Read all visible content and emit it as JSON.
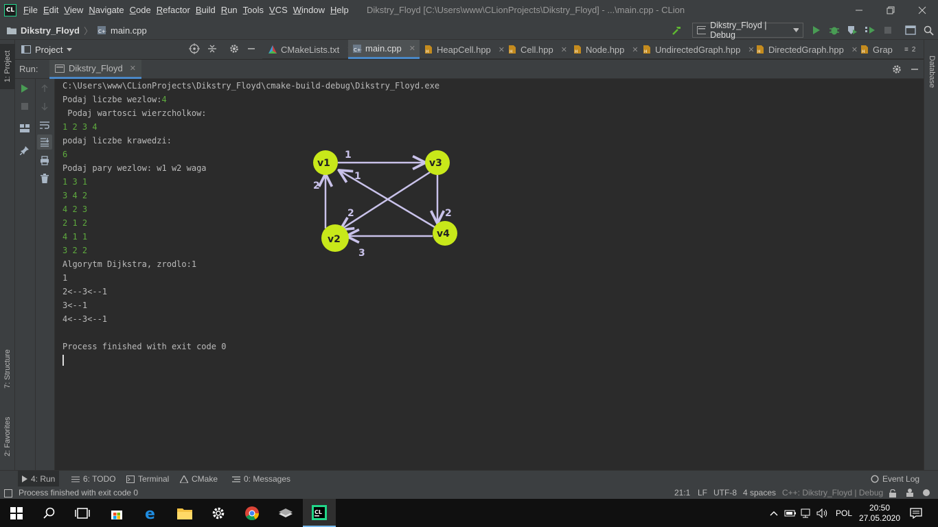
{
  "window": {
    "app_logo": "CL",
    "title": "Dikstry_Floyd [C:\\Users\\www\\CLionProjects\\Dikstry_Floyd] - ...\\main.cpp - CLion",
    "minimize_icon": "minimize-icon",
    "restore_icon": "restore-icon",
    "close_icon": "close-icon"
  },
  "menu": [
    "File",
    "Edit",
    "View",
    "Navigate",
    "Code",
    "Refactor",
    "Build",
    "Run",
    "Tools",
    "VCS",
    "Window",
    "Help"
  ],
  "navbar": {
    "project": "Dikstry_Floyd",
    "file": "main.cpp",
    "run_config": "Dikstry_Floyd | Debug"
  },
  "left_strip": {
    "project_tab": "1: Project",
    "structure_tab": "7: Structure",
    "favorites_tab": "2: Favorites"
  },
  "right_strip": {
    "database_tab": "Database"
  },
  "project_panel": {
    "label": "Project"
  },
  "tabs": [
    {
      "label": "CMakeLists.txt",
      "icon": "cmake-icon"
    },
    {
      "label": "main.cpp",
      "icon": "cpp-file-icon",
      "active": true
    },
    {
      "label": "HeapCell.hpp",
      "icon": "header-file-icon"
    },
    {
      "label": "Cell.hpp",
      "icon": "header-file-icon"
    },
    {
      "label": "Node.hpp",
      "icon": "header-file-icon"
    },
    {
      "label": "UndirectedGraph.hpp",
      "icon": "header-file-icon"
    },
    {
      "label": "DirectedGraph.hpp",
      "icon": "header-file-icon"
    },
    {
      "label": "Grap",
      "icon": "header-file-icon"
    }
  ],
  "tabs_overflow": "2",
  "run_panel": {
    "label": "Run:",
    "tab": "Dikstry_Floyd"
  },
  "console": {
    "lines": [
      {
        "text": "C:\\Users\\www\\CLionProjects\\Dikstry_Floyd\\cmake-build-debug\\Dikstry_Floyd.exe",
        "input": ""
      },
      {
        "text": "Podaj liczbe wezlow:",
        "input": "4"
      },
      {
        "text": " Podaj wartosci wierzcholkow:",
        "input": ""
      },
      {
        "text": "",
        "input": "1 2 3 4"
      },
      {
        "text": "podaj liczbe krawedzi:",
        "input": ""
      },
      {
        "text": "",
        "input": "6"
      },
      {
        "text": "Podaj pary wezlow: w1 w2 waga",
        "input": ""
      },
      {
        "text": "",
        "input": "1 3 1"
      },
      {
        "text": "",
        "input": "3 4 2"
      },
      {
        "text": "",
        "input": "4 2 3"
      },
      {
        "text": "",
        "input": "2 1 2"
      },
      {
        "text": "",
        "input": "4 1 1"
      },
      {
        "text": "",
        "input": "3 2 2"
      },
      {
        "text": "Algorytm Dijkstra, zrodlo:1",
        "input": ""
      },
      {
        "text": "1",
        "input": ""
      },
      {
        "text": "2<--3<--1",
        "input": ""
      },
      {
        "text": "3<--1",
        "input": ""
      },
      {
        "text": "4<--3<--1",
        "input": ""
      },
      {
        "text": "",
        "input": ""
      },
      {
        "text": "Process finished with exit code 0",
        "input": ""
      }
    ]
  },
  "graph": {
    "nodes": [
      "v1",
      "v2",
      "v3",
      "v4"
    ],
    "node_color": "#c8e81a",
    "edge_color": "#c9c2ea",
    "weights": {
      "v1_v3": "1",
      "v4_v1": "1",
      "v2_v1": "2",
      "v3_v4": "2",
      "v3_v2": "2",
      "v4_v2": "3"
    }
  },
  "bottom_tools": [
    {
      "label": "4: Run",
      "icon": "run-icon",
      "active": true
    },
    {
      "label": "6: TODO",
      "icon": "todo-icon"
    },
    {
      "label": "Terminal",
      "icon": "terminal-icon"
    },
    {
      "label": "CMake",
      "icon": "cmake-icon"
    },
    {
      "label": "0: Messages",
      "icon": "messages-icon"
    }
  ],
  "event_log": "Event Log",
  "status": {
    "message": "Process finished with exit code 0",
    "position": "21:1",
    "line_sep": "LF",
    "encoding": "UTF-8",
    "indent": "4 spaces",
    "context": "C++: Dikstry_Floyd | Debug"
  },
  "taskbar": {
    "language": "POL",
    "time": "20:50",
    "date": "27.05.2020"
  },
  "colors": {
    "accent": "#4a88c7",
    "run_green": "#499c54",
    "console_input": "#5eaa3e"
  }
}
